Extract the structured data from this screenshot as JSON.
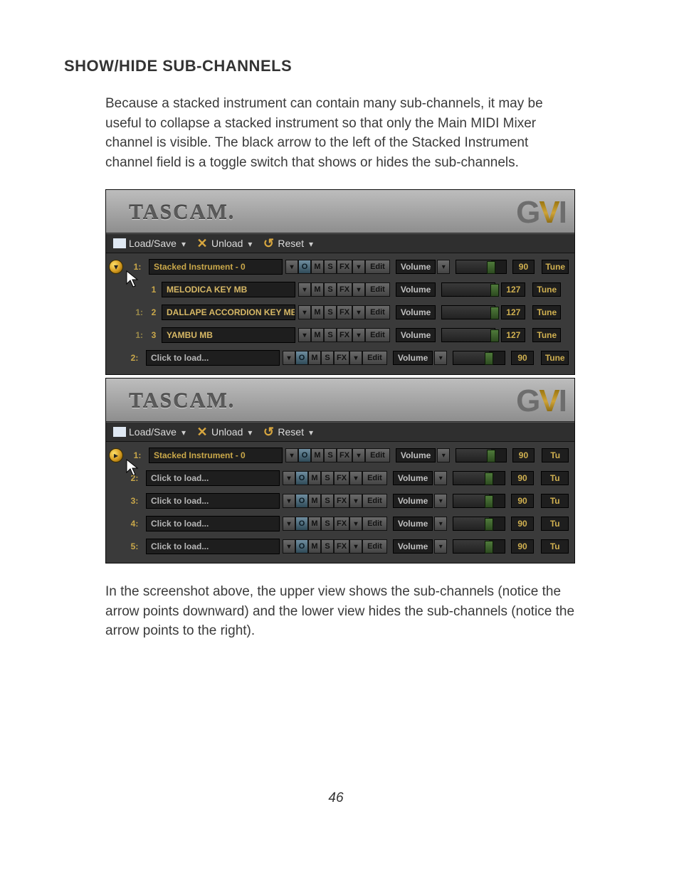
{
  "heading": "SHOW/HIDE SUB-CHANNELS",
  "intro": "Because a stacked instrument can contain many sub-channels, it may be useful to collapse a stacked instrument so that only the Main MIDI Mixer channel is visible. The black arrow to the left of the Stacked Instrument channel field is a toggle switch that shows or hides the sub-channels.",
  "outro": "In the screenshot above, the upper view shows the sub-channels (notice the arrow points downward) and the lower view hides the sub-channels (notice the arrow points to the right).",
  "page_number": "46",
  "brand_tascam": "TASCAM.",
  "brand_g": "G",
  "brand_v": "V",
  "brand_i": "I",
  "toolbar": {
    "loadsave": "Load/Save",
    "unload": "Unload",
    "reset": "Reset"
  },
  "labels": {
    "volume": "Volume",
    "tune": "Tune",
    "tu": "Tu",
    "edit": "Edit",
    "m": "M",
    "s": "S",
    "fx": "FX",
    "o": "O",
    "click_to_load": "Click to load..."
  },
  "upper": {
    "rows": [
      {
        "idx": "1:",
        "name": "Stacked Instrument - 0",
        "vol": 90,
        "tune": "Tune",
        "hasO": true,
        "hasVolDD": true,
        "fill": 70,
        "main": true
      },
      {
        "prefix": "",
        "subnum": "1",
        "name": "MELODICA  KEY MB",
        "vol": 127,
        "tune": "Tune",
        "hasO": false,
        "hasVolDD": false,
        "fill": 100,
        "main": false
      },
      {
        "prefix": "1:",
        "subnum": "2",
        "name": "DALLAPE ACCORDION KEY  MB",
        "vol": 127,
        "tune": "Tune",
        "hasO": false,
        "hasVolDD": false,
        "fill": 100,
        "main": false,
        "nameDD": true
      },
      {
        "prefix": "1:",
        "subnum": "3",
        "name": "YAMBU  MB",
        "vol": 127,
        "tune": "Tune",
        "hasO": false,
        "hasVolDD": false,
        "fill": 100,
        "main": false
      },
      {
        "idx": "2:",
        "name": "Click to load...",
        "vol": 90,
        "tune": "Tune",
        "hasO": true,
        "hasVolDD": true,
        "fill": 70,
        "main": true,
        "empty": true
      }
    ]
  },
  "lower": {
    "rows": [
      {
        "idx": "1:",
        "name": "Stacked Instrument - 0",
        "vol": 90,
        "tune": "Tu",
        "hasO": true,
        "hasVolDD": true,
        "fill": 70,
        "main": true
      },
      {
        "idx": "2:",
        "name": "Click to load...",
        "vol": 90,
        "tune": "Tu",
        "hasO": true,
        "hasVolDD": true,
        "fill": 70,
        "main": true,
        "empty": true
      },
      {
        "idx": "3:",
        "name": "Click to load...",
        "vol": 90,
        "tune": "Tu",
        "hasO": true,
        "hasVolDD": true,
        "fill": 70,
        "main": true,
        "empty": true
      },
      {
        "idx": "4:",
        "name": "Click to load...",
        "vol": 90,
        "tune": "Tu",
        "hasO": true,
        "hasVolDD": true,
        "fill": 70,
        "main": true,
        "empty": true
      },
      {
        "idx": "5:",
        "name": "Click to load...",
        "vol": 90,
        "tune": "Tu",
        "hasO": true,
        "hasVolDD": true,
        "fill": 70,
        "main": true,
        "empty": true
      }
    ]
  }
}
